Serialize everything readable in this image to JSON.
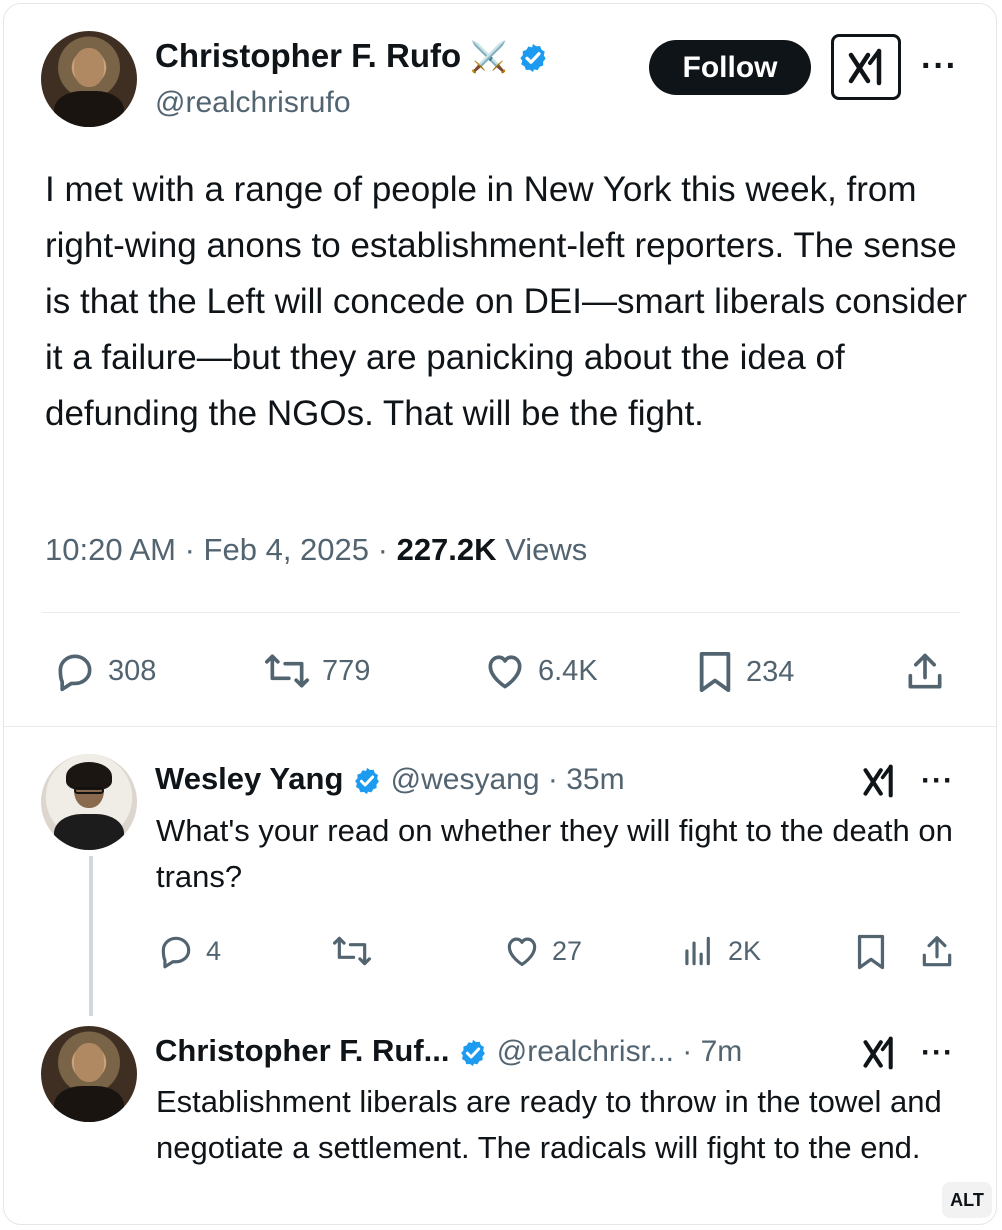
{
  "main_tweet": {
    "author_name": "Christopher F. Rufo",
    "author_emoji": "⚔️",
    "author_handle": "@realchrisrufo",
    "follow_label": "Follow",
    "more_label": "···",
    "text": "I met with a range of people in New York this week, from right-wing anons to establishment-left reporters. The sense is that the Left will concede on DEI—smart liberals consider it a failure—but they are panicking about the idea of defunding the NGOs. That will be the fight.",
    "time": "10:20 AM",
    "date": "Feb 4, 2025",
    "views_count": "227.2K",
    "views_label": "Views",
    "replies": "308",
    "reposts": "779",
    "likes": "6.4K",
    "bookmarks": "234"
  },
  "reply_1": {
    "author_name": "Wesley Yang",
    "author_handle": "@wesyang",
    "age": "35m",
    "text": "What's your read on whether they will fight to the death on trans?",
    "replies": "4",
    "likes": "27",
    "views": "2K",
    "more_label": "···"
  },
  "reply_2": {
    "author_name": "Christopher F. Ruf...",
    "author_handle": "@realchrisr...",
    "age": "7m",
    "text": "Establishment liberals are ready to throw in the towel and negotiate a settlement. The radicals will fight to the end.",
    "more_label": "···"
  },
  "alt_label": "ALT",
  "colors": {
    "text": "#0f1419",
    "secondary": "#536471",
    "verified": "#1d9bf0",
    "divider": "#e8ecef"
  },
  "icons": [
    "reply-icon",
    "repost-icon",
    "like-icon",
    "bookmark-icon",
    "share-icon",
    "views-icon",
    "verified-badge-icon",
    "grok-icon",
    "crossed-swords-icon"
  ]
}
